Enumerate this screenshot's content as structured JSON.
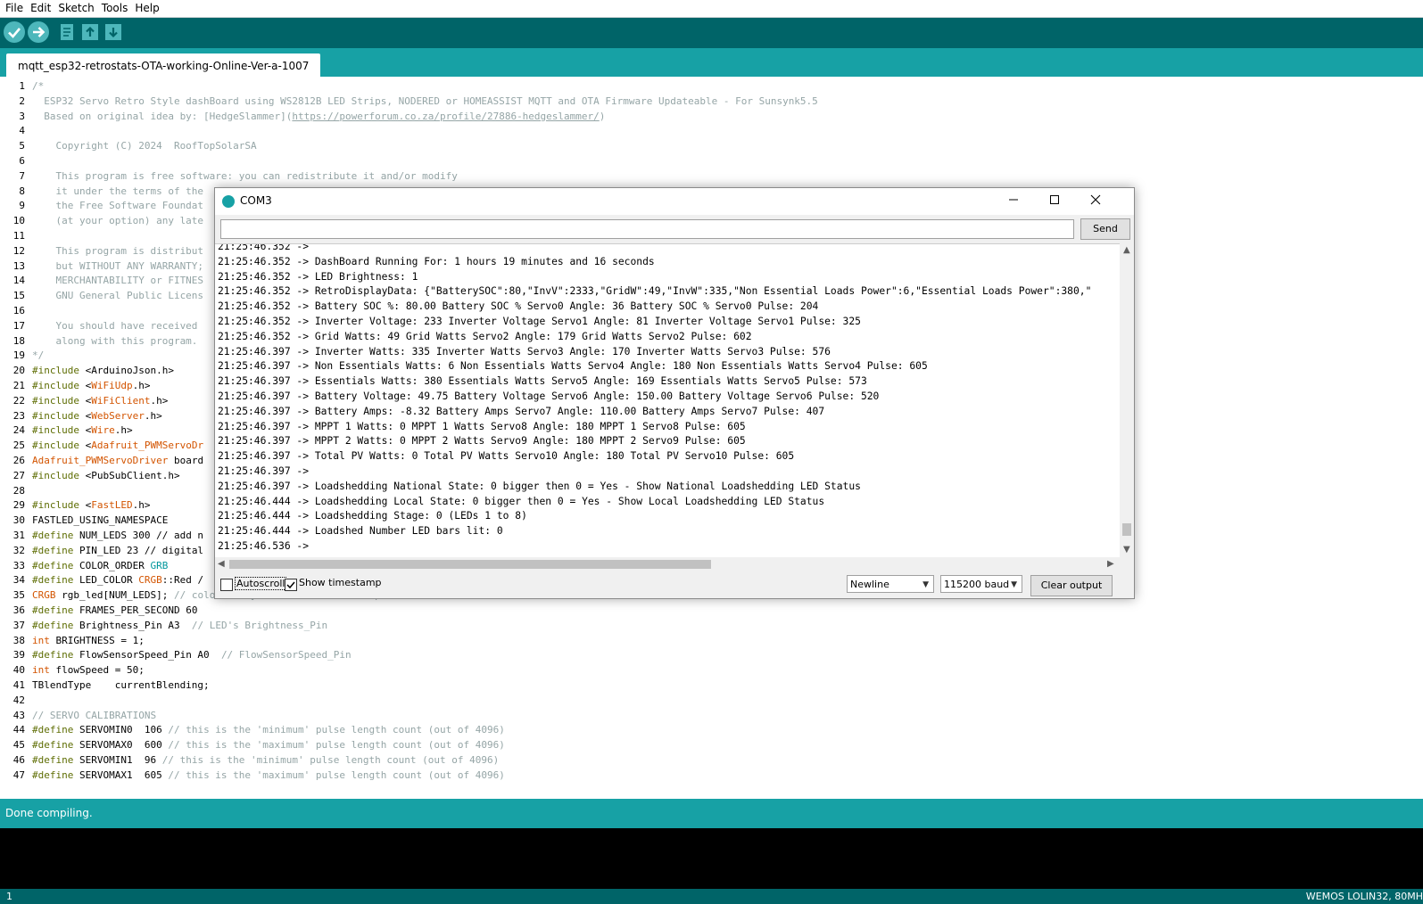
{
  "menu": [
    "File",
    "Edit",
    "Sketch",
    "Tools",
    "Help"
  ],
  "toolbar": {
    "verify_icon": "check-icon",
    "upload_icon": "arrow-right-icon",
    "new_icon": "new-file-icon",
    "open_icon": "open-arrow-up-icon",
    "save_icon": "save-arrow-down-icon"
  },
  "tab": {
    "label": "mqtt_esp32-retrostats-OTA-working-Online-Ver-a-1007"
  },
  "code": [
    {
      "n": "1",
      "segs": [
        {
          "t": "/*",
          "c": "cmt"
        }
      ]
    },
    {
      "n": "2",
      "segs": [
        {
          "t": "  ESP32 Servo Retro Style dashBoard using WS2812B LED Strips, NODERED or HOMEASSIST MQTT and OTA Firmware Updateable - For Sunsynk5.5",
          "c": "cmt"
        }
      ]
    },
    {
      "n": "3",
      "segs": [
        {
          "t": "  Based on original idea by: [HedgeSlammer](",
          "c": "cmt"
        },
        {
          "t": "https://powerforum.co.za/profile/27886-hedgeslammer/",
          "c": "cmt lnk"
        },
        {
          "t": ")",
          "c": "cmt"
        }
      ]
    },
    {
      "n": "4",
      "segs": []
    },
    {
      "n": "5",
      "segs": [
        {
          "t": "    Copyright (C) 2024  RoofTopSolarSA",
          "c": "cmt"
        }
      ]
    },
    {
      "n": "6",
      "segs": []
    },
    {
      "n": "7",
      "segs": [
        {
          "t": "    This program is free software: you can redistribute it and/or modify",
          "c": "cmt"
        }
      ]
    },
    {
      "n": "8",
      "segs": [
        {
          "t": "    it under the terms of the",
          "c": "cmt"
        }
      ]
    },
    {
      "n": "9",
      "segs": [
        {
          "t": "    the Free Software Foundat",
          "c": "cmt"
        }
      ]
    },
    {
      "n": "10",
      "segs": [
        {
          "t": "    (at your option) any late",
          "c": "cmt"
        }
      ]
    },
    {
      "n": "11",
      "segs": []
    },
    {
      "n": "12",
      "segs": [
        {
          "t": "    This program is distribut",
          "c": "cmt"
        }
      ]
    },
    {
      "n": "13",
      "segs": [
        {
          "t": "    but WITHOUT ANY WARRANTY;",
          "c": "cmt"
        }
      ]
    },
    {
      "n": "14",
      "segs": [
        {
          "t": "    MERCHANTABILITY or FITNES",
          "c": "cmt"
        }
      ]
    },
    {
      "n": "15",
      "segs": [
        {
          "t": "    GNU General Public Licens",
          "c": "cmt"
        }
      ]
    },
    {
      "n": "16",
      "segs": []
    },
    {
      "n": "17",
      "segs": [
        {
          "t": "    You should have received ",
          "c": "cmt"
        }
      ]
    },
    {
      "n": "18",
      "segs": [
        {
          "t": "    along with this program. ",
          "c": "cmt"
        }
      ]
    },
    {
      "n": "19",
      "segs": [
        {
          "t": "*/",
          "c": "cmt"
        }
      ]
    },
    {
      "n": "20",
      "segs": [
        {
          "t": "#include ",
          "c": "kw"
        },
        {
          "t": "<ArduinoJson.h>",
          "c": ""
        }
      ]
    },
    {
      "n": "21",
      "segs": [
        {
          "t": "#include ",
          "c": "kw"
        },
        {
          "t": "<",
          "c": ""
        },
        {
          "t": "WiFiUdp",
          "c": "ty"
        },
        {
          "t": ".h>",
          "c": ""
        }
      ]
    },
    {
      "n": "22",
      "segs": [
        {
          "t": "#include ",
          "c": "kw"
        },
        {
          "t": "<",
          "c": ""
        },
        {
          "t": "WiFiClient",
          "c": "ty"
        },
        {
          "t": ".h>",
          "c": ""
        }
      ]
    },
    {
      "n": "23",
      "segs": [
        {
          "t": "#include ",
          "c": "kw"
        },
        {
          "t": "<",
          "c": ""
        },
        {
          "t": "WebServer",
          "c": "ty"
        },
        {
          "t": ".h>",
          "c": ""
        }
      ]
    },
    {
      "n": "24",
      "segs": [
        {
          "t": "#include ",
          "c": "kw"
        },
        {
          "t": "<",
          "c": ""
        },
        {
          "t": "Wire",
          "c": "ty"
        },
        {
          "t": ".h>",
          "c": ""
        }
      ]
    },
    {
      "n": "25",
      "segs": [
        {
          "t": "#include ",
          "c": "kw"
        },
        {
          "t": "<",
          "c": ""
        },
        {
          "t": "Adafruit_PWMServoDr",
          "c": "ty"
        }
      ]
    },
    {
      "n": "26",
      "segs": [
        {
          "t": "Adafruit_PWMServoDriver",
          "c": "ty"
        },
        {
          "t": " board",
          "c": ""
        }
      ]
    },
    {
      "n": "27",
      "segs": [
        {
          "t": "#include ",
          "c": "kw"
        },
        {
          "t": "<PubSubClient.h>",
          "c": ""
        }
      ]
    },
    {
      "n": "28",
      "segs": []
    },
    {
      "n": "29",
      "segs": [
        {
          "t": "#include ",
          "c": "kw"
        },
        {
          "t": "<",
          "c": ""
        },
        {
          "t": "FastLED",
          "c": "ty"
        },
        {
          "t": ".h>",
          "c": ""
        }
      ]
    },
    {
      "n": "30",
      "segs": [
        {
          "t": "FASTLED_USING_NAMESPACE",
          "c": ""
        }
      ]
    },
    {
      "n": "31",
      "segs": [
        {
          "t": "#define ",
          "c": "kw"
        },
        {
          "t": "NUM_LEDS 300 // add n",
          "c": ""
        }
      ]
    },
    {
      "n": "32",
      "segs": [
        {
          "t": "#define ",
          "c": "kw"
        },
        {
          "t": "PIN_LED 23 // digital",
          "c": ""
        }
      ]
    },
    {
      "n": "33",
      "segs": [
        {
          "t": "#define ",
          "c": "kw"
        },
        {
          "t": "COLOR_ORDER ",
          "c": ""
        },
        {
          "t": "GRB",
          "c": "kw2"
        }
      ]
    },
    {
      "n": "34",
      "segs": [
        {
          "t": "#define ",
          "c": "kw"
        },
        {
          "t": "LED_COLOR ",
          "c": ""
        },
        {
          "t": "CRGB",
          "c": "ty"
        },
        {
          "t": "::Red /",
          "c": ""
        }
      ]
    },
    {
      "n": "35",
      "segs": [
        {
          "t": "CRGB",
          "c": "ty"
        },
        {
          "t": " rgb_led[NUM_LEDS]; ",
          "c": ""
        },
        {
          "t": "// color array of the LED RGB strip",
          "c": "cmt"
        }
      ]
    },
    {
      "n": "36",
      "segs": [
        {
          "t": "#define ",
          "c": "kw"
        },
        {
          "t": "FRAMES_PER_SECOND 60",
          "c": ""
        }
      ]
    },
    {
      "n": "37",
      "segs": [
        {
          "t": "#define ",
          "c": "kw"
        },
        {
          "t": "Brightness_Pin A3  ",
          "c": ""
        },
        {
          "t": "// LED's Brightness_Pin",
          "c": "cmt"
        }
      ]
    },
    {
      "n": "38",
      "segs": [
        {
          "t": "int",
          "c": "ty"
        },
        {
          "t": " BRIGHTNESS = 1;",
          "c": ""
        }
      ]
    },
    {
      "n": "39",
      "segs": [
        {
          "t": "#define ",
          "c": "kw"
        },
        {
          "t": "FlowSensorSpeed_Pin A0  ",
          "c": ""
        },
        {
          "t": "// FlowSensorSpeed_Pin",
          "c": "cmt"
        }
      ]
    },
    {
      "n": "40",
      "segs": [
        {
          "t": "int",
          "c": "ty"
        },
        {
          "t": " flowSpeed = 50;",
          "c": ""
        }
      ]
    },
    {
      "n": "41",
      "segs": [
        {
          "t": "TBlendType    currentBlending;",
          "c": ""
        }
      ]
    },
    {
      "n": "42",
      "segs": []
    },
    {
      "n": "43",
      "segs": [
        {
          "t": "// SERVO CALIBRATIONS",
          "c": "cmt"
        }
      ]
    },
    {
      "n": "44",
      "segs": [
        {
          "t": "#define ",
          "c": "kw"
        },
        {
          "t": "SERVOMIN0  106 ",
          "c": ""
        },
        {
          "t": "// this is the 'minimum' pulse length count (out of 4096)",
          "c": "cmt"
        }
      ]
    },
    {
      "n": "45",
      "segs": [
        {
          "t": "#define ",
          "c": "kw"
        },
        {
          "t": "SERVOMAX0  600 ",
          "c": ""
        },
        {
          "t": "// this is the 'maximum' pulse length count (out of 4096)",
          "c": "cmt"
        }
      ]
    },
    {
      "n": "46",
      "segs": [
        {
          "t": "#define ",
          "c": "kw"
        },
        {
          "t": "SERVOMIN1  96 ",
          "c": ""
        },
        {
          "t": "// this is the 'minimum' pulse length count (out of 4096)",
          "c": "cmt"
        }
      ]
    },
    {
      "n": "47",
      "segs": [
        {
          "t": "#define ",
          "c": "kw"
        },
        {
          "t": "SERVOMAX1  605 ",
          "c": ""
        },
        {
          "t": "// this is the 'maximum' pulse length count (out of 4096)",
          "c": "cmt"
        }
      ]
    }
  ],
  "status": {
    "message": "Done compiling."
  },
  "bottom": {
    "line": "1",
    "board": "WEMOS LOLIN32, 80MH"
  },
  "serial": {
    "title": "COM3",
    "input_value": "",
    "send_label": "Send",
    "lines": [
      "21:25:46.352 ->",
      "21:25:46.352 -> DashBoard Running For: 1 hours 19 minutes and 16 seconds",
      "21:25:46.352 -> LED Brightness: 1",
      "21:25:46.352 -> RetroDisplayData: {\"BatterySOC\":80,\"InvV\":2333,\"GridW\":49,\"InvW\":335,\"Non Essential Loads Power\":6,\"Essential Loads Power\":380,\"",
      "21:25:46.352 -> Battery SOC %: 80.00 Battery SOC % Servo0 Angle: 36 Battery SOC % Servo0 Pulse: 204",
      "21:25:46.352 -> Inverter Voltage: 233 Inverter Voltage Servo1 Angle: 81 Inverter Voltage Servo1 Pulse: 325",
      "21:25:46.352 -> Grid Watts: 49 Grid Watts Servo2 Angle: 179 Grid Watts Servo2 Pulse: 602",
      "21:25:46.397 -> Inverter Watts: 335 Inverter Watts Servo3 Angle: 170 Inverter Watts Servo3 Pulse: 576",
      "21:25:46.397 -> Non Essentials Watts: 6 Non Essentials Watts Servo4 Angle: 180 Non Essentials Watts Servo4 Pulse: 605",
      "21:25:46.397 -> Essentials Watts: 380 Essentials Watts Servo5 Angle: 169 Essentials Watts Servo5 Pulse: 573",
      "21:25:46.397 -> Battery Voltage: 49.75 Battery Voltage Servo6 Angle: 150.00 Battery Voltage Servo6 Pulse: 520",
      "21:25:46.397 -> Battery Amps: -8.32 Battery Amps Servo7 Angle: 110.00 Battery Amps Servo7 Pulse: 407",
      "21:25:46.397 -> MPPT 1 Watts: 0 MPPT 1 Watts Servo8 Angle: 180 MPPT 1 Servo8 Pulse: 605",
      "21:25:46.397 -> MPPT 2 Watts: 0 MPPT 2 Watts Servo9 Angle: 180 MPPT 2 Servo9 Pulse: 605",
      "21:25:46.397 -> Total PV Watts: 0 Total PV Watts Servo10 Angle: 180 Total PV Servo10 Pulse: 605",
      "21:25:46.397 ->",
      "21:25:46.397 -> Loadshedding National State: 0 bigger then 0 = Yes - Show National Loadshedding LED Status",
      "21:25:46.444 -> Loadshedding Local State: 0 bigger then 0 = Yes - Show Local Loadshedding LED Status",
      "21:25:46.444 -> Loadshedding Stage: 0 (LEDs 1 to 8)",
      "21:25:46.444 -> Loadshed Number LED bars lit: 0",
      "21:25:46.536 ->"
    ],
    "autoscroll": {
      "label": "Autoscroll",
      "checked": false
    },
    "timestamp": {
      "label": "Show timestamp",
      "checked": true
    },
    "line_ending": "Newline",
    "baud": "115200 baud",
    "clear_label": "Clear output"
  }
}
